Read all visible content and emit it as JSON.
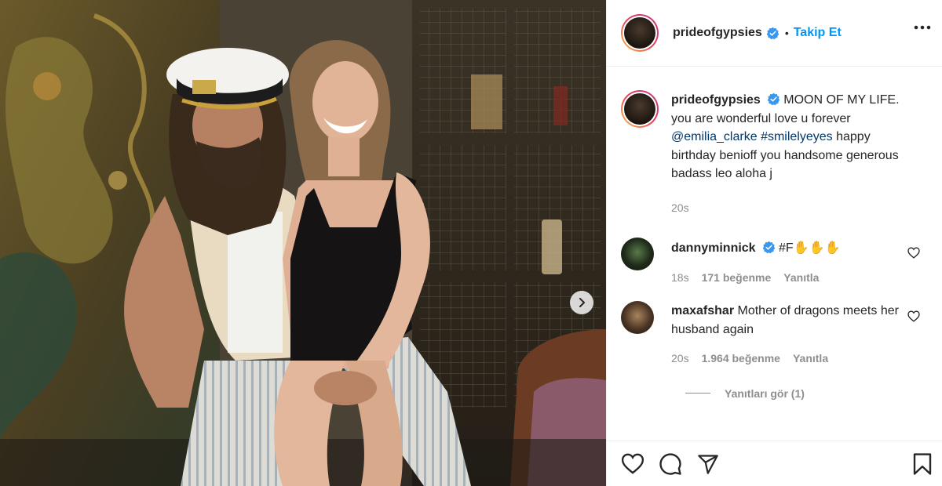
{
  "header": {
    "username": "prideofgypsies",
    "separator": "•",
    "follow_label": "Takip Et"
  },
  "caption": {
    "username": "prideofgypsies",
    "text_start": "MOON OF MY LIFE. you are wonderful love u forever ",
    "mention": "@emilia_clarke",
    "space": " ",
    "hashtag": "#smilelyeyes",
    "text_end": " happy birthday benioff you handsome generous badass leo aloha j",
    "time": "20s"
  },
  "comments": [
    {
      "username": "dannyminnick",
      "text": "#F✋✋✋",
      "time": "18s",
      "likes": "171 beğenme",
      "reply_label": "Yanıtla"
    },
    {
      "username": "maxafshar",
      "text": "Mother of dragons meets her husband again",
      "time": "20s",
      "likes": "1.964 beğenme",
      "reply_label": "Yanıtla",
      "view_replies": "Yanıtları gör (1)"
    }
  ],
  "icons": {
    "verified": "verified-badge-icon",
    "more": "more-options-icon",
    "like": "heart-icon",
    "comment": "comment-icon",
    "share": "share-icon",
    "save": "bookmark-icon",
    "next": "chevron-right-icon"
  },
  "colors": {
    "accent": "#0095f6",
    "verified": "#3897f0",
    "text": "#262626",
    "muted": "#8e8e8e"
  }
}
